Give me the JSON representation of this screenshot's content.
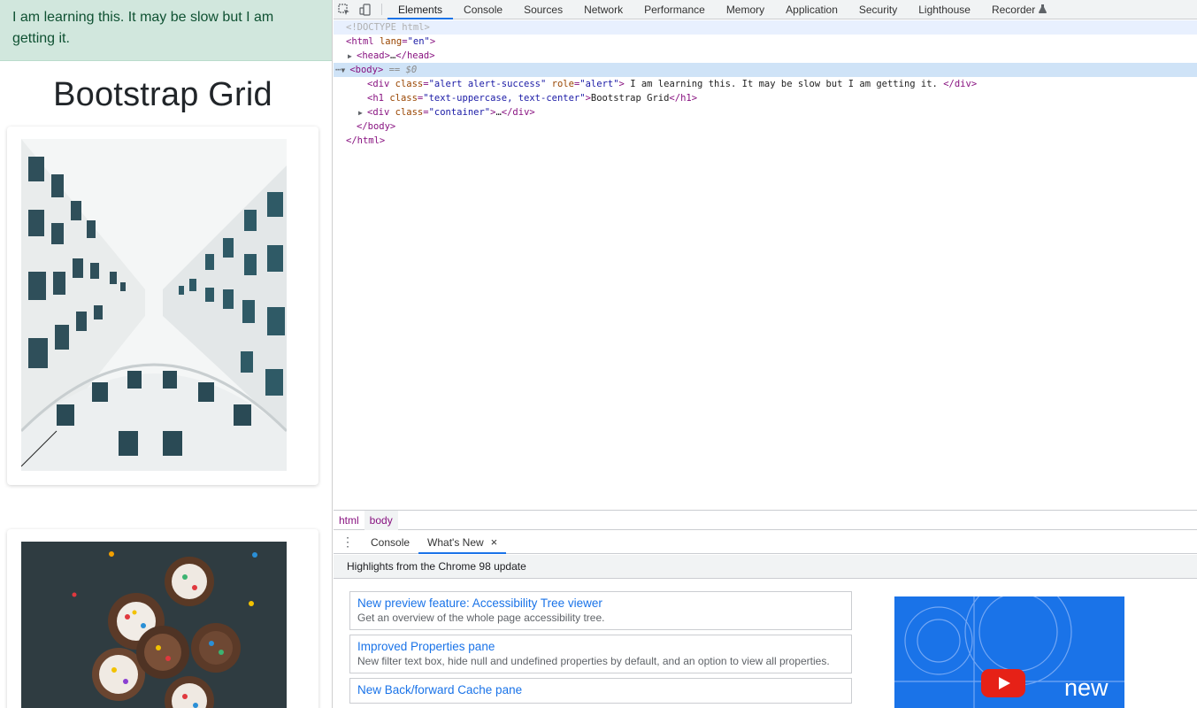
{
  "page": {
    "alert_text": "I am learning this. It may be slow but I am getting it.",
    "heading": "Bootstrap Grid"
  },
  "devtools": {
    "toolbar_icons": [
      "select-element-icon",
      "device-toolbar-icon"
    ],
    "tabs": [
      "Elements",
      "Console",
      "Sources",
      "Network",
      "Performance",
      "Memory",
      "Application",
      "Security",
      "Lighthouse",
      "Recorder"
    ],
    "active_tab": "Elements",
    "dom": {
      "doctype": "<!DOCTYPE html>",
      "html_open_tag": "html",
      "html_attr_name": "lang",
      "html_attr_value": "\"en\"",
      "head": "head",
      "head_ellipsis": "…",
      "body": "body",
      "body_marker": "== $0",
      "alert_tag": "div",
      "alert_class_attr": "class",
      "alert_class_value": "\"alert alert-success\"",
      "alert_role_attr": "role",
      "alert_role_value": "\"alert\"",
      "alert_text": " I am learning this. It may be slow but I am getting it. ",
      "h1_tag": "h1",
      "h1_class_attr": "class",
      "h1_class_value": "\"text-uppercase, text-center\"",
      "h1_text": "Bootstrap Grid",
      "container_tag": "div",
      "container_class_attr": "class",
      "container_class_value": "\"container\"",
      "container_ellipsis": "…",
      "body_close": "</body>",
      "html_close": "</html>"
    },
    "breadcrumbs": [
      "html",
      "body"
    ],
    "drawer": {
      "menu_icon": "more-vertical-icon",
      "tabs": [
        "Console",
        "What's New"
      ],
      "active_tab": "What's New",
      "close_label": "×",
      "header": "Highlights from the Chrome 98 update",
      "items": [
        {
          "title": "New preview feature: Accessibility Tree viewer",
          "desc": "Get an overview of the whole page accessibility tree."
        },
        {
          "title": "Improved Properties pane",
          "desc": "New filter text box, hide null and undefined properties by default, and an option to view all properties."
        },
        {
          "title": "New Back/forward Cache pane",
          "desc": ""
        }
      ],
      "video_label": "new"
    }
  },
  "colors": {
    "alert_bg": "#d1e7dd",
    "alert_text": "#0f5132",
    "devtools_accent": "#1a73e8",
    "tag": "#881280",
    "attr_name": "#994500",
    "attr_value": "#1a1aa6"
  }
}
